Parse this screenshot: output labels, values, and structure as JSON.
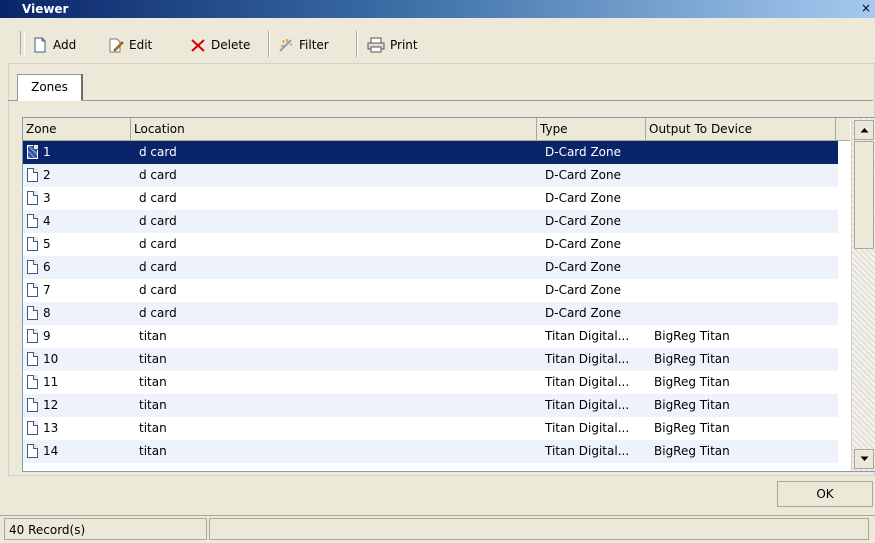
{
  "window": {
    "title": "Viewer",
    "close_label": "×"
  },
  "toolbar": {
    "add_label": "Add",
    "edit_label": "Edit",
    "delete_label": "Delete",
    "filter_label": "Filter",
    "print_label": "Print"
  },
  "tabs": [
    {
      "label": "Zones"
    }
  ],
  "grid": {
    "columns": [
      "Zone",
      "Location",
      "Type",
      "Output To Device"
    ],
    "rows": [
      {
        "zone": "1",
        "location": "d card",
        "type": "D-Card Zone",
        "output": ""
      },
      {
        "zone": "2",
        "location": "d card",
        "type": "D-Card Zone",
        "output": ""
      },
      {
        "zone": "3",
        "location": "d card",
        "type": "D-Card Zone",
        "output": ""
      },
      {
        "zone": "4",
        "location": "d card",
        "type": "D-Card Zone",
        "output": ""
      },
      {
        "zone": "5",
        "location": "d card",
        "type": "D-Card Zone",
        "output": ""
      },
      {
        "zone": "6",
        "location": "d card",
        "type": "D-Card Zone",
        "output": ""
      },
      {
        "zone": "7",
        "location": "d card",
        "type": "D-Card Zone",
        "output": ""
      },
      {
        "zone": "8",
        "location": "d card",
        "type": "D-Card Zone",
        "output": ""
      },
      {
        "zone": "9",
        "location": "titan",
        "type": "Titan Digital...",
        "output": "BigReg Titan"
      },
      {
        "zone": "10",
        "location": "titan",
        "type": "Titan Digital...",
        "output": "BigReg Titan"
      },
      {
        "zone": "11",
        "location": "titan",
        "type": "Titan Digital...",
        "output": "BigReg Titan"
      },
      {
        "zone": "12",
        "location": "titan",
        "type": "Titan Digital...",
        "output": "BigReg Titan"
      },
      {
        "zone": "13",
        "location": "titan",
        "type": "Titan Digital...",
        "output": "BigReg Titan"
      },
      {
        "zone": "14",
        "location": "titan",
        "type": "Titan Digital...",
        "output": "BigReg Titan"
      }
    ]
  },
  "buttons": {
    "ok_label": "OK"
  },
  "status": {
    "records": "40 Record(s)"
  },
  "colors": {
    "selection": "#0a246a",
    "alt_row": "#eef2fa",
    "title_bar": "#0a246a"
  },
  "icons": [
    "add-icon",
    "edit-icon",
    "delete-icon",
    "filter-icon",
    "print-icon",
    "document-icon",
    "scroll-up-icon",
    "scroll-down-icon"
  ]
}
